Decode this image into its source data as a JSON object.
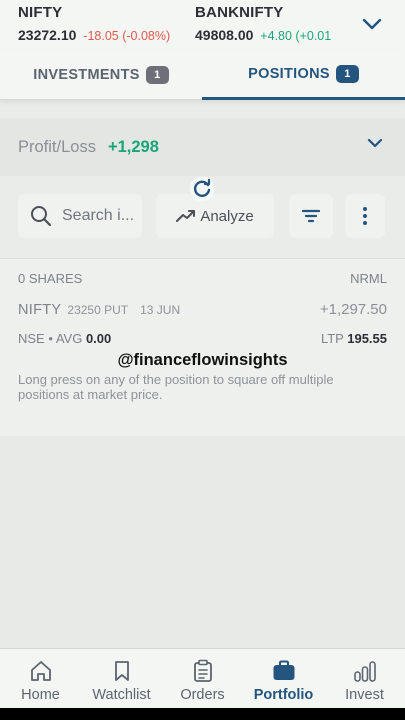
{
  "ticker": {
    "items": [
      {
        "name": "NIFTY",
        "value": "23272.10",
        "change": "-18.05 (-0.08%)",
        "direction": "down"
      },
      {
        "name": "BANKNIFTY",
        "value": "49808.00",
        "change": "+4.80 (+0.01",
        "direction": "up"
      }
    ],
    "toggle_icon": "chevron-down-icon"
  },
  "tabs": [
    {
      "label": "INVESTMENTS",
      "count": "1",
      "active": false
    },
    {
      "label": "POSITIONS",
      "count": "1",
      "active": true
    }
  ],
  "profit_loss": {
    "label": "Profit/Loss",
    "value": "+1,298"
  },
  "toolbar": {
    "search_placeholder": "Search i...",
    "analyze_label": "Analyze"
  },
  "position": {
    "shares": "0 SHARES",
    "product": "NRML",
    "symbol": "NIFTY",
    "strike": "23250 PUT",
    "expiry": "13 JUN",
    "pnl": "+1,297.50",
    "exchange": "NSE",
    "avg_label": "AVG",
    "avg_value": "0.00",
    "ltp_label": "LTP",
    "ltp_value": "195.55"
  },
  "watermark": "@financeflowinsights",
  "hint": "Long press on any of the position to square off multiple positions at market price.",
  "bottom_nav": [
    {
      "label": "Home",
      "icon": "home-icon",
      "active": false
    },
    {
      "label": "Watchlist",
      "icon": "bookmark-icon",
      "active": false
    },
    {
      "label": "Orders",
      "icon": "clipboard-icon",
      "active": false
    },
    {
      "label": "Portfolio",
      "icon": "briefcase-icon",
      "active": true
    },
    {
      "label": "Invest",
      "icon": "bar-chart-icon",
      "active": false
    }
  ],
  "colors": {
    "accent": "#23557f",
    "positive": "#1aa67a",
    "negative": "#e2574c"
  }
}
